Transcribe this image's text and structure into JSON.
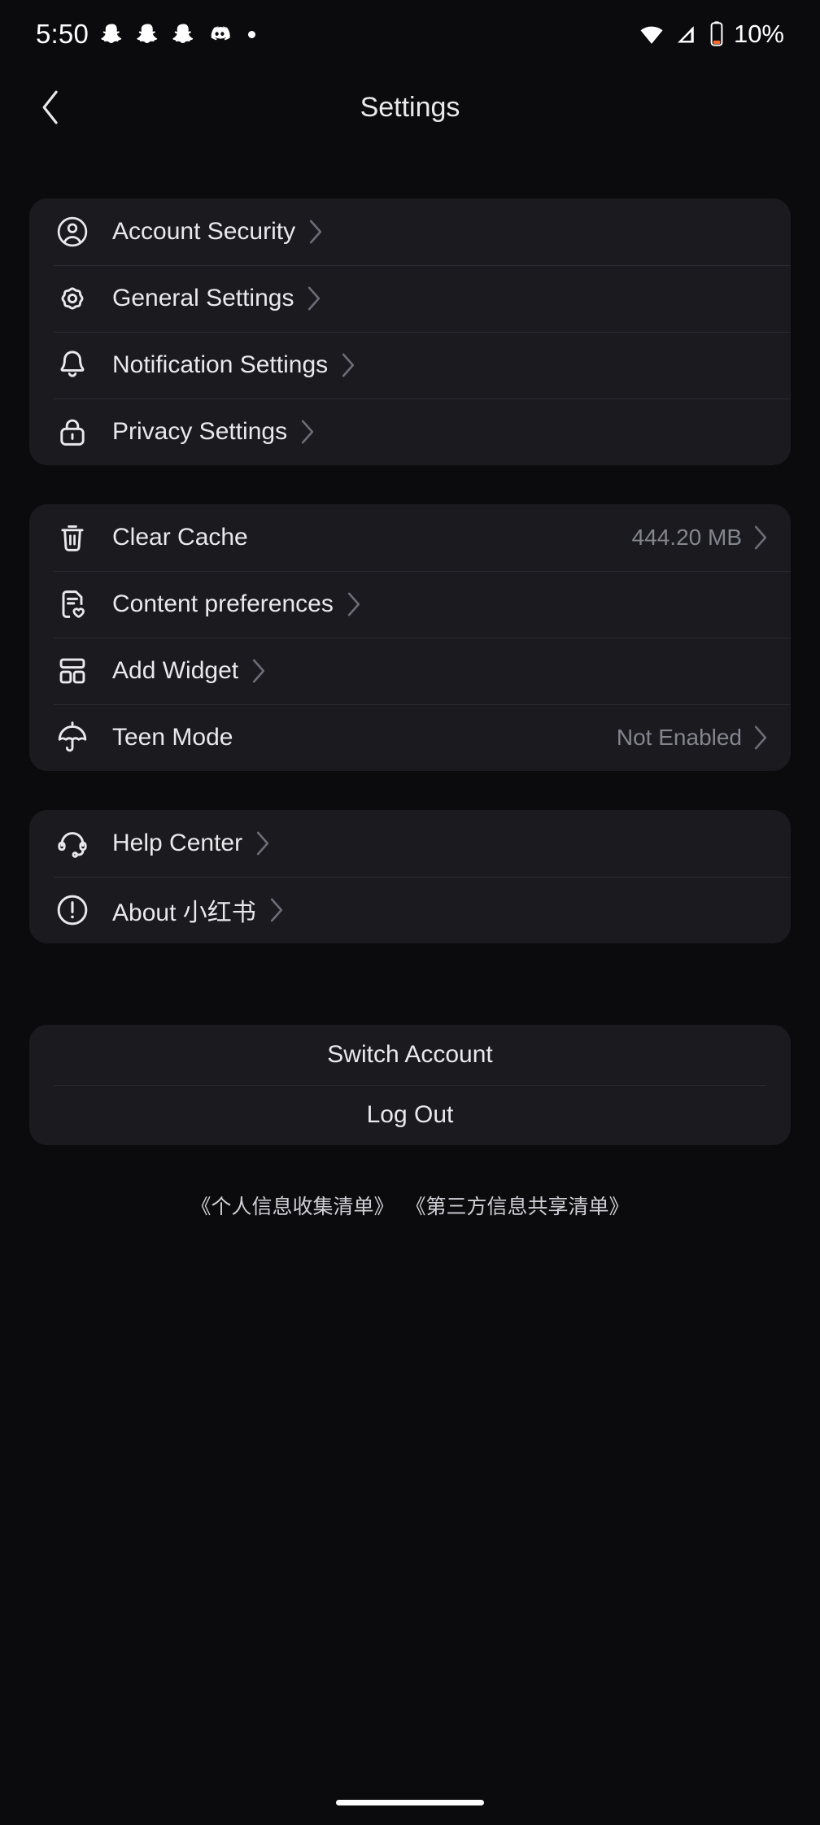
{
  "status_bar": {
    "time": "5:50",
    "left_icons": [
      "snapchat-ghost-icon",
      "snapchat-ghost-icon",
      "snapchat-ghost-icon",
      "discord-icon",
      "dot-icon"
    ],
    "right_icons": [
      "wifi-icon",
      "cellular-signal-icon",
      "battery-icon"
    ],
    "battery_percent": "10%"
  },
  "header": {
    "back_icon": "chevron-left-icon",
    "title": "Settings"
  },
  "sections": [
    {
      "name": "account-section",
      "rows": [
        {
          "icon": "person-circle-icon",
          "label": "Account Security",
          "value": "",
          "chevron": "chevron-right-icon"
        },
        {
          "icon": "gear-icon",
          "label": "General Settings",
          "value": "",
          "chevron": "chevron-right-icon"
        },
        {
          "icon": "bell-icon",
          "label": "Notification Settings",
          "value": "",
          "chevron": "chevron-right-icon"
        },
        {
          "icon": "lock-icon",
          "label": "Privacy Settings",
          "value": "",
          "chevron": "chevron-right-icon"
        }
      ]
    },
    {
      "name": "preferences-section",
      "rows": [
        {
          "icon": "trash-icon",
          "label": "Clear Cache",
          "value": "444.20 MB",
          "chevron": "chevron-right-icon"
        },
        {
          "icon": "document-heart-icon",
          "label": "Content preferences",
          "value": "",
          "chevron": "chevron-right-icon"
        },
        {
          "icon": "widget-grid-icon",
          "label": "Add Widget",
          "value": "",
          "chevron": "chevron-right-icon"
        },
        {
          "icon": "umbrella-icon",
          "label": "Teen Mode",
          "value": "Not Enabled",
          "chevron": "chevron-right-icon"
        }
      ]
    },
    {
      "name": "support-section",
      "rows": [
        {
          "icon": "headset-icon",
          "label": "Help Center",
          "value": "",
          "chevron": "chevron-right-icon"
        },
        {
          "icon": "exclamation-circle-icon",
          "label": "About 小红书",
          "value": "",
          "chevron": "chevron-right-icon"
        }
      ]
    }
  ],
  "actions": [
    {
      "label": "Switch Account"
    },
    {
      "label": "Log Out"
    }
  ],
  "footer": {
    "links": [
      "《个人信息收集清单》",
      "《第三方信息共享清单》"
    ]
  },
  "colors": {
    "page_background": "#0b0b0d",
    "card_background": "#1a1a1f",
    "divider": "#2b2b31",
    "primary_text": "#e9e9ec",
    "secondary_text": "#85858e",
    "battery_low": "#ff6a2b"
  }
}
